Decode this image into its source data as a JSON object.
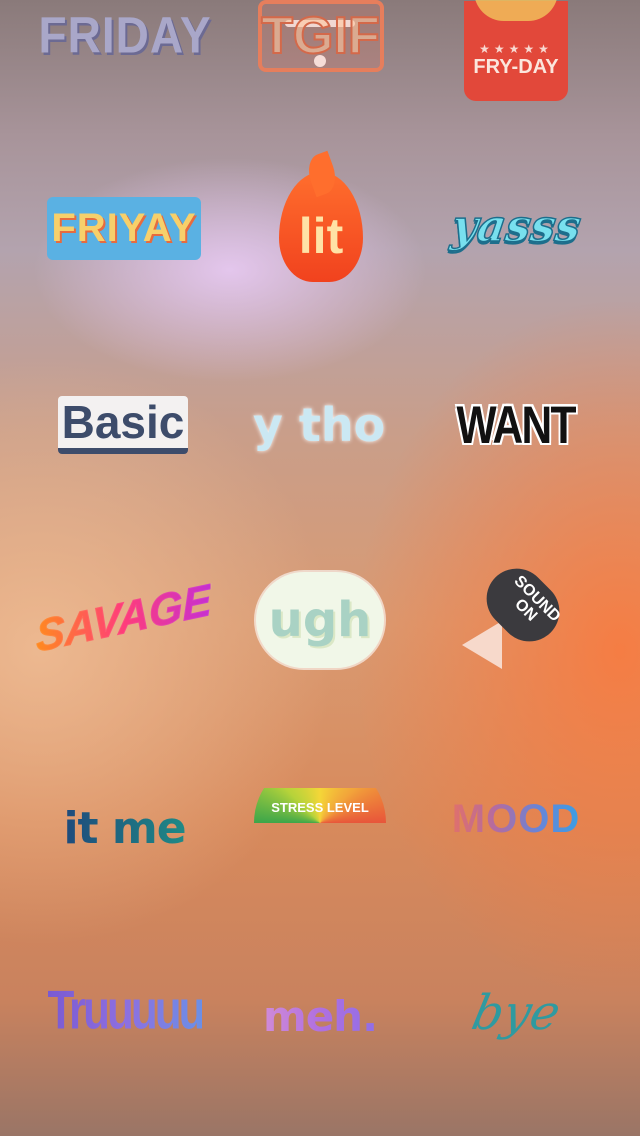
{
  "stickers": {
    "friday": "FRIDAY",
    "tgif": "TGIF",
    "fryday": "FRY-DAY",
    "friyay": "FRIYAY",
    "lit": "lit",
    "yasss": "yasss",
    "basic": "Basic",
    "ytho": "y tho",
    "want": "WANT",
    "savage": "SAVAGE",
    "ugh": "ugh",
    "sound_on_line1": "SOUND",
    "sound_on_line2": "ON",
    "itme": "it me",
    "stress_level": "STRESS LEVEL",
    "mood": "MOOD",
    "truuuuu": "Truuuuu",
    "meh": "meh.",
    "bye": "bye"
  },
  "colors": {
    "background_top": "#8a7a7a",
    "background_mid": "#d99a72",
    "accent_orange": "#ff6e2d"
  },
  "icons": {
    "drawer_handle": "drag-handle-icon",
    "page_indicator": "page-dot-icon",
    "speaker": "speaker-icon"
  }
}
